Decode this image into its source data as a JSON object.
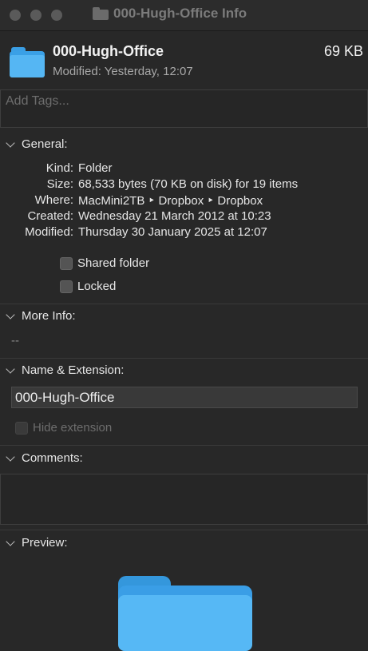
{
  "window": {
    "title": "000-Hugh-Office Info"
  },
  "header": {
    "name": "000-Hugh-Office",
    "size": "69 KB",
    "modified": "Modified: Yesterday, 12:07"
  },
  "tags": {
    "placeholder": "Add Tags..."
  },
  "general": {
    "title": "General:",
    "rows": [
      {
        "label": "Kind:",
        "value": "Folder"
      },
      {
        "label": "Size:",
        "value": "68,533 bytes (70 KB on disk) for 19 items"
      },
      {
        "label": "Where:",
        "value": "MacMini2TB ‣ Dropbox ‣ Dropbox"
      },
      {
        "label": "Created:",
        "value": "Wednesday 21 March 2012 at 10:23"
      },
      {
        "label": "Modified:",
        "value": "Thursday 30 January 2025 at 12:07"
      }
    ],
    "shared_folder": {
      "label": "Shared folder",
      "checked": false
    },
    "locked": {
      "label": "Locked",
      "checked": false
    }
  },
  "more_info": {
    "title": "More Info:",
    "value": "--"
  },
  "name_extension": {
    "title": "Name & Extension:",
    "name_value": "000-Hugh-Office",
    "hide_extension": {
      "label": "Hide extension",
      "checked": false,
      "enabled": false
    }
  },
  "comments": {
    "title": "Comments:",
    "value": ""
  },
  "preview": {
    "title": "Preview:"
  },
  "colors": {
    "background": "#282828",
    "folder_blue": "#56b8f5",
    "traffic_light_inactive": "#5a5a5a"
  }
}
